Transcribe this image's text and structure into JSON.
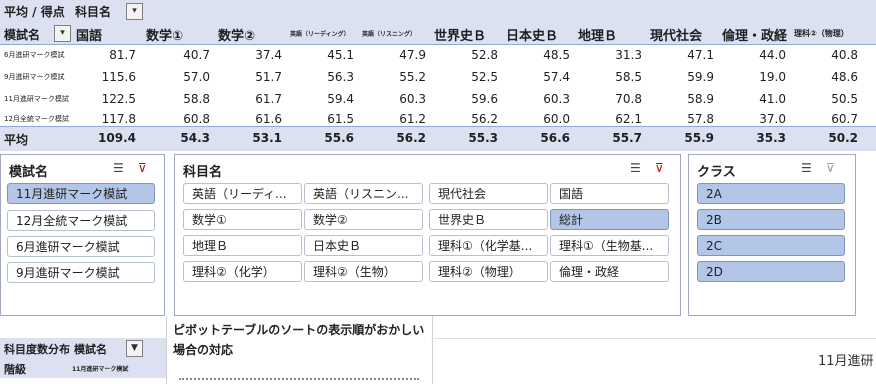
{
  "pivot": {
    "row1": {
      "label_a": "平均 / 得点",
      "label_b": "科目名"
    },
    "row_header": "模試名",
    "columns": [
      "国語",
      "数学①",
      "数学②",
      "英語（リーディング）",
      "英語（リスニング）",
      "世界史Ｂ",
      "日本史Ｂ",
      "地理Ｂ",
      "現代社会",
      "倫理・政経",
      "理科②（物理）"
    ],
    "rows": [
      {
        "label": "6月進研マーク模試",
        "values": [
          "81.7",
          "40.7",
          "37.4",
          "45.1",
          "47.9",
          "52.8",
          "48.5",
          "31.3",
          "47.1",
          "44.0",
          "40.8"
        ]
      },
      {
        "label": "9月進研マーク模試",
        "values": [
          "115.6",
          "57.0",
          "51.7",
          "56.3",
          "55.2",
          "52.5",
          "57.4",
          "58.5",
          "59.9",
          "19.0",
          "48.6"
        ]
      },
      {
        "label": "11月進研マーク模試",
        "values": [
          "122.5",
          "58.8",
          "61.7",
          "59.4",
          "60.3",
          "59.6",
          "60.3",
          "70.8",
          "58.9",
          "41.0",
          "50.5"
        ]
      },
      {
        "label": "12月全統マーク模試",
        "values": [
          "117.8",
          "60.8",
          "61.6",
          "61.5",
          "61.2",
          "56.2",
          "60.0",
          "62.1",
          "57.8",
          "37.0",
          "60.7"
        ]
      }
    ],
    "total": {
      "label": "平均",
      "values": [
        "109.4",
        "54.3",
        "53.1",
        "55.6",
        "56.2",
        "55.3",
        "56.6",
        "55.7",
        "55.9",
        "35.3",
        "50.2"
      ]
    }
  },
  "slicer_exam": {
    "title": "模試名",
    "items": [
      {
        "label": "11月進研マーク模試",
        "selected": true
      },
      {
        "label": "12月全統マーク模試",
        "selected": false
      },
      {
        "label": "6月進研マーク模試",
        "selected": false
      },
      {
        "label": "9月進研マーク模試",
        "selected": false
      }
    ]
  },
  "slicer_subject": {
    "title": "科目名",
    "items": [
      {
        "label": "英語（リーディ...",
        "selected": false
      },
      {
        "label": "英語（リスニン...",
        "selected": false
      },
      {
        "label": "現代社会",
        "selected": false
      },
      {
        "label": "国語",
        "selected": false
      },
      {
        "label": "数学①",
        "selected": false
      },
      {
        "label": "数学②",
        "selected": false
      },
      {
        "label": "世界史Ｂ",
        "selected": false
      },
      {
        "label": "総計",
        "selected": true
      },
      {
        "label": "地理Ｂ",
        "selected": false
      },
      {
        "label": "日本史Ｂ",
        "selected": false
      },
      {
        "label": "理科①（化学基...",
        "selected": false
      },
      {
        "label": "理科①（生物基...",
        "selected": false
      },
      {
        "label": "理科②（化学）",
        "selected": false
      },
      {
        "label": "理科②（生物）",
        "selected": false
      },
      {
        "label": "理科②（物理）",
        "selected": false
      },
      {
        "label": "倫理・政経",
        "selected": false
      }
    ]
  },
  "slicer_class": {
    "title": "クラス",
    "items": [
      {
        "label": "2A",
        "selected": true
      },
      {
        "label": "2B",
        "selected": true
      },
      {
        "label": "2C",
        "selected": true
      },
      {
        "label": "2D",
        "selected": true
      }
    ]
  },
  "pivot2": {
    "label_a": "科目度数分布",
    "label_b": "模試名",
    "row_header": "階級",
    "filter_value": "11月進研マーク模試"
  },
  "note": {
    "text": "ピボットテーブルのソートの表示順がおかしい場合の対応"
  },
  "right_text": "11月進研"
}
